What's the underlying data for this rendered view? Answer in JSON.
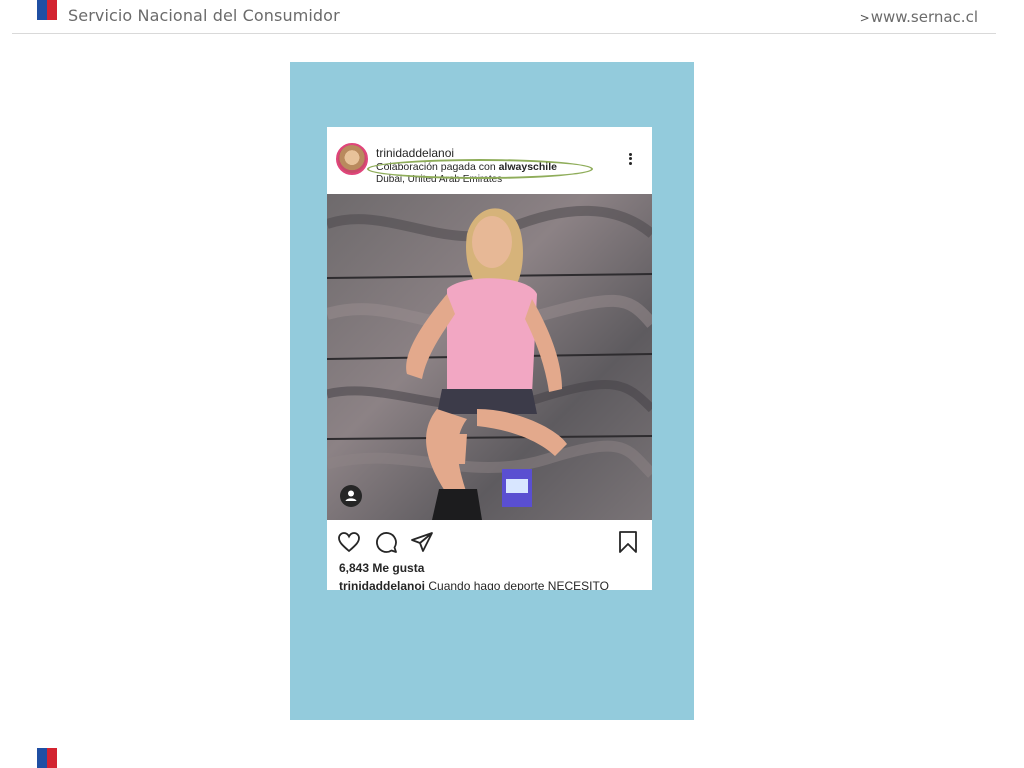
{
  "header": {
    "org_name": "Servicio Nacional del Consumidor",
    "site_link": "www.sernac.cl",
    "link_arrow": ">"
  },
  "colors": {
    "flag_blue": "#1f4fa3",
    "flag_red": "#d32330",
    "panel": "#93cbdc",
    "highlight": "#8fad5a"
  },
  "post": {
    "username": "trinidaddelanoi",
    "sponsor_prefix": "Colaboración pagada con ",
    "sponsor_brand": "alwayschile",
    "location": "Dubai, United Arab Emirates",
    "likes": "6,843 Me gusta",
    "caption_user": "trinidaddelanoi",
    "caption_text": " Cuando hago deporte NECESITO"
  },
  "icons": {
    "more": "more-vertical-icon",
    "like": "heart-icon",
    "comment": "comment-icon",
    "share": "send-icon",
    "save": "bookmark-icon",
    "tag": "user-tag-icon"
  }
}
